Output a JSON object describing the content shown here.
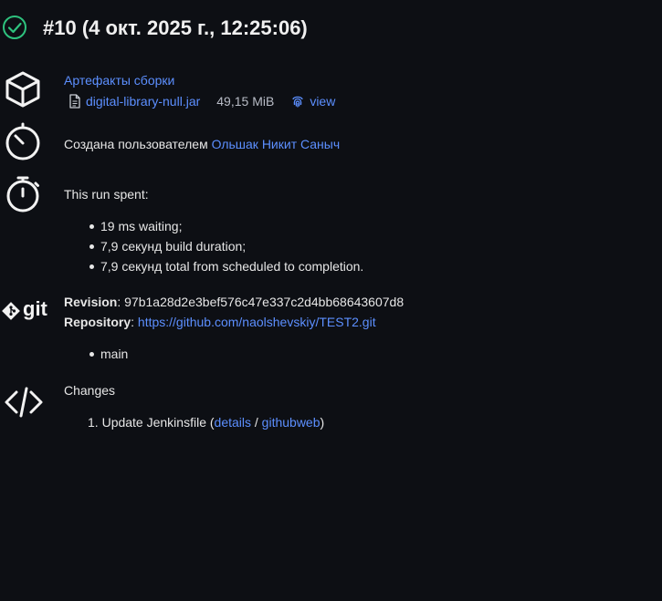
{
  "header": {
    "title": "#10 (4 окт. 2025 г., 12:25:06)",
    "status": "success"
  },
  "artifacts": {
    "heading": "Артефакты сборки",
    "file_name": "digital-library-null.jar",
    "file_size": "49,15 MiB",
    "view_label": "view"
  },
  "created": {
    "prefix": "Создана пользователем ",
    "user": "Ольшак Никит Саныч"
  },
  "timing": {
    "heading": "This run spent:",
    "items": [
      "19 ms waiting;",
      "7,9 секунд build duration;",
      "7,9 секунд total from scheduled to completion."
    ]
  },
  "git": {
    "logo_text": "git",
    "revision_label": "Revision",
    "revision_value": ": 97b1a28d2e3bef576c47e337c2d4bb68643607d8",
    "repository_label": "Repository",
    "repository_sep": ": ",
    "repository_url": "https://github.com/naolshevskiy/TEST2.git",
    "branches": [
      "main"
    ]
  },
  "changes": {
    "heading": "Changes",
    "items": [
      {
        "number": "1.",
        "text": "Update Jenkinsfile (",
        "details_label": "details",
        "sep": " / ",
        "githubweb_label": "githubweb",
        "close": ")"
      }
    ]
  },
  "colors": {
    "background": "#0d0f14",
    "link": "#5c8fff",
    "success": "#2ec27e"
  }
}
